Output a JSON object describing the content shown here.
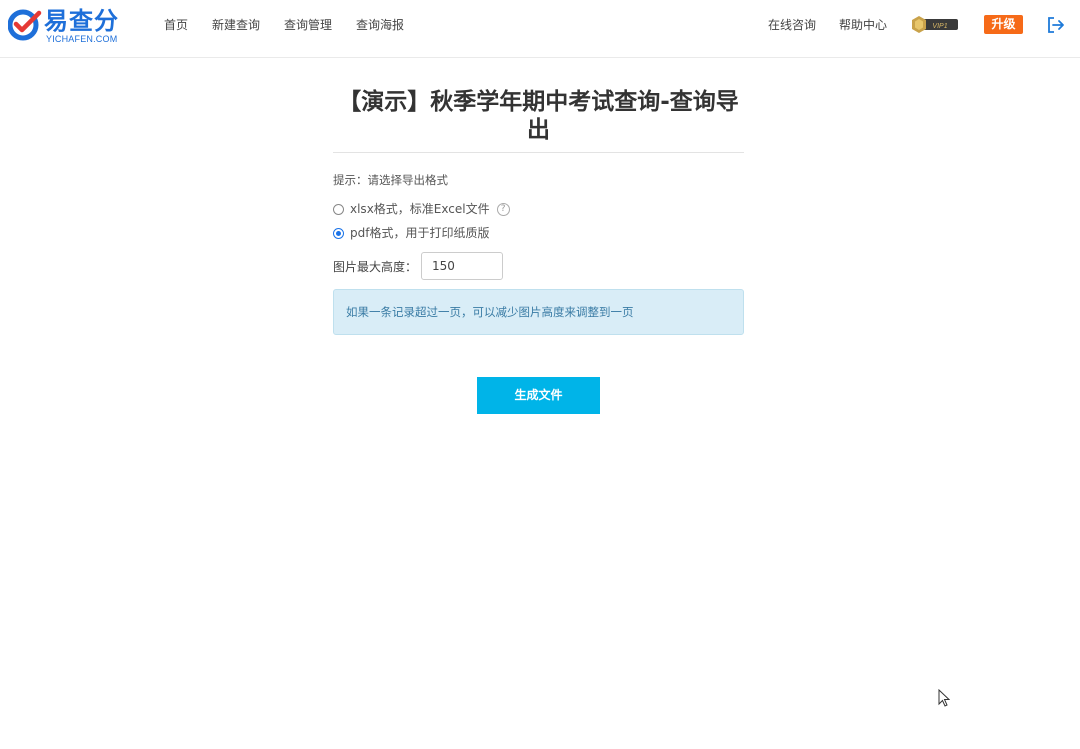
{
  "header": {
    "logo": {
      "text": "易查分",
      "sub": "YICHAFEN.COM"
    },
    "nav": [
      {
        "label": "首页"
      },
      {
        "label": "新建查询"
      },
      {
        "label": "查询管理"
      },
      {
        "label": "查询海报"
      }
    ],
    "right": {
      "consult": "在线咨询",
      "help": "帮助中心",
      "vip": "VIP1",
      "upgrade": "升级",
      "logout_icon": "logout-icon"
    }
  },
  "page": {
    "title": "【演示】秋季学年期中考试查询-查询导出",
    "hint": "提示：请选择导出格式",
    "options": [
      {
        "label": "xlsx格式，标准Excel文件",
        "checked": false,
        "help": "?"
      },
      {
        "label": "pdf格式，用于打印纸质版",
        "checked": true
      }
    ],
    "image_height": {
      "label": "图片最大高度：",
      "value": "150"
    },
    "info": "如果一条记录超过一页，可以减少图片高度来调整到一页",
    "generate_label": "生成文件"
  },
  "colors": {
    "brand": "#1e6fd9",
    "upgrade": "#f66a18",
    "primary_button": "#00b4e8",
    "info_bg": "#d9edf7",
    "info_text": "#3a7ca5"
  }
}
